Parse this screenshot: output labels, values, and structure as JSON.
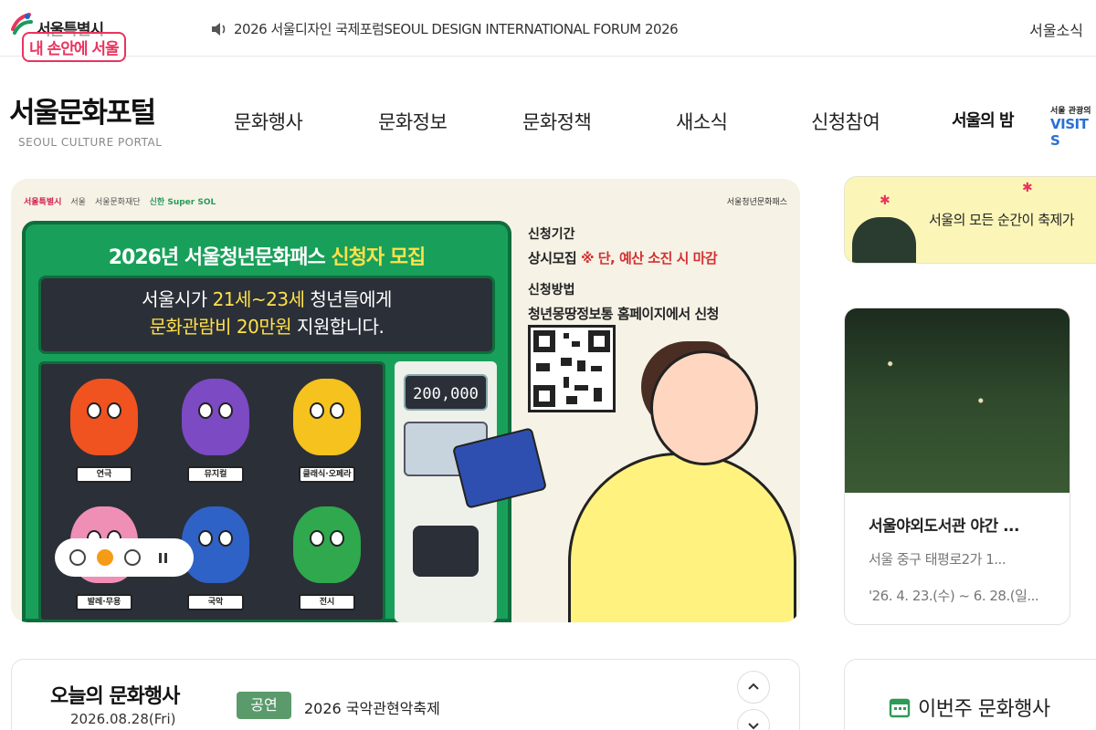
{
  "topbar": {
    "city_name": "서울특별시",
    "slogan": "내 손안에 서울",
    "notice": "2026 서울디자인 국제포럼SEOUL DESIGN INTERNATIONAL FORUM 2026",
    "news_link": "서울소식"
  },
  "header": {
    "logo_ko": "서울문화포털",
    "logo_en": "SEOUL CULTURE PORTAL",
    "nav": [
      "문화행사",
      "문화정보",
      "문화정책",
      "새소식",
      "신청참여"
    ],
    "night_logo": "서울의 밤",
    "visit_small": "서울 관광의",
    "visit_big": "VISIT S"
  },
  "banner": {
    "sponsors": [
      "서울특별시",
      "서울",
      "서울문화재단",
      "신한 Super SOL"
    ],
    "foundation": "서울청년문화패스",
    "title_main": "2026년 서울청년문화패스 ",
    "title_hl": "신청자 모집",
    "screen_line1_pre": "서울시가 ",
    "screen_line1_hl": "21세~23세",
    "screen_line1_post": " 청년들에게",
    "screen_line2_hl": "문화관람비 20만원",
    "screen_line2_post": " 지원합니다.",
    "counter": "200,000",
    "items": [
      "연극",
      "뮤지컬",
      "클래식·오페라",
      "발레·무용",
      "국악",
      "전시"
    ],
    "period_label": "신청기간",
    "period_value": "상시모집 ",
    "period_warn": "※ 단, 예산 소진 시 마감",
    "method_label": "신청방법",
    "method_value": "청년몽땅정보통 홈페이지에서 신청",
    "active_slide": 2,
    "total_slides": 3
  },
  "side_banner": {
    "text": "서울의 모든 순간이 축제가"
  },
  "event_card": {
    "title": "서울야외도서관 야간 ...",
    "place": "서울 중구 태평로2가 1...",
    "date": "'26. 4. 23.(수) ~ 6. 28.(일..."
  },
  "today": {
    "title": "오늘의 문화행사",
    "date": "2026.08.28(Fri)",
    "category": "공연",
    "event": "2026 국악관현악축제"
  },
  "week": {
    "title": "이번주 문화행사"
  },
  "colors": {
    "accent_pink": "#e9345d",
    "banner_green": "#18a05a",
    "highlight_yellow": "#ffe14a",
    "slider_active": "#f59b16",
    "category_green": "#5a9a6b"
  }
}
